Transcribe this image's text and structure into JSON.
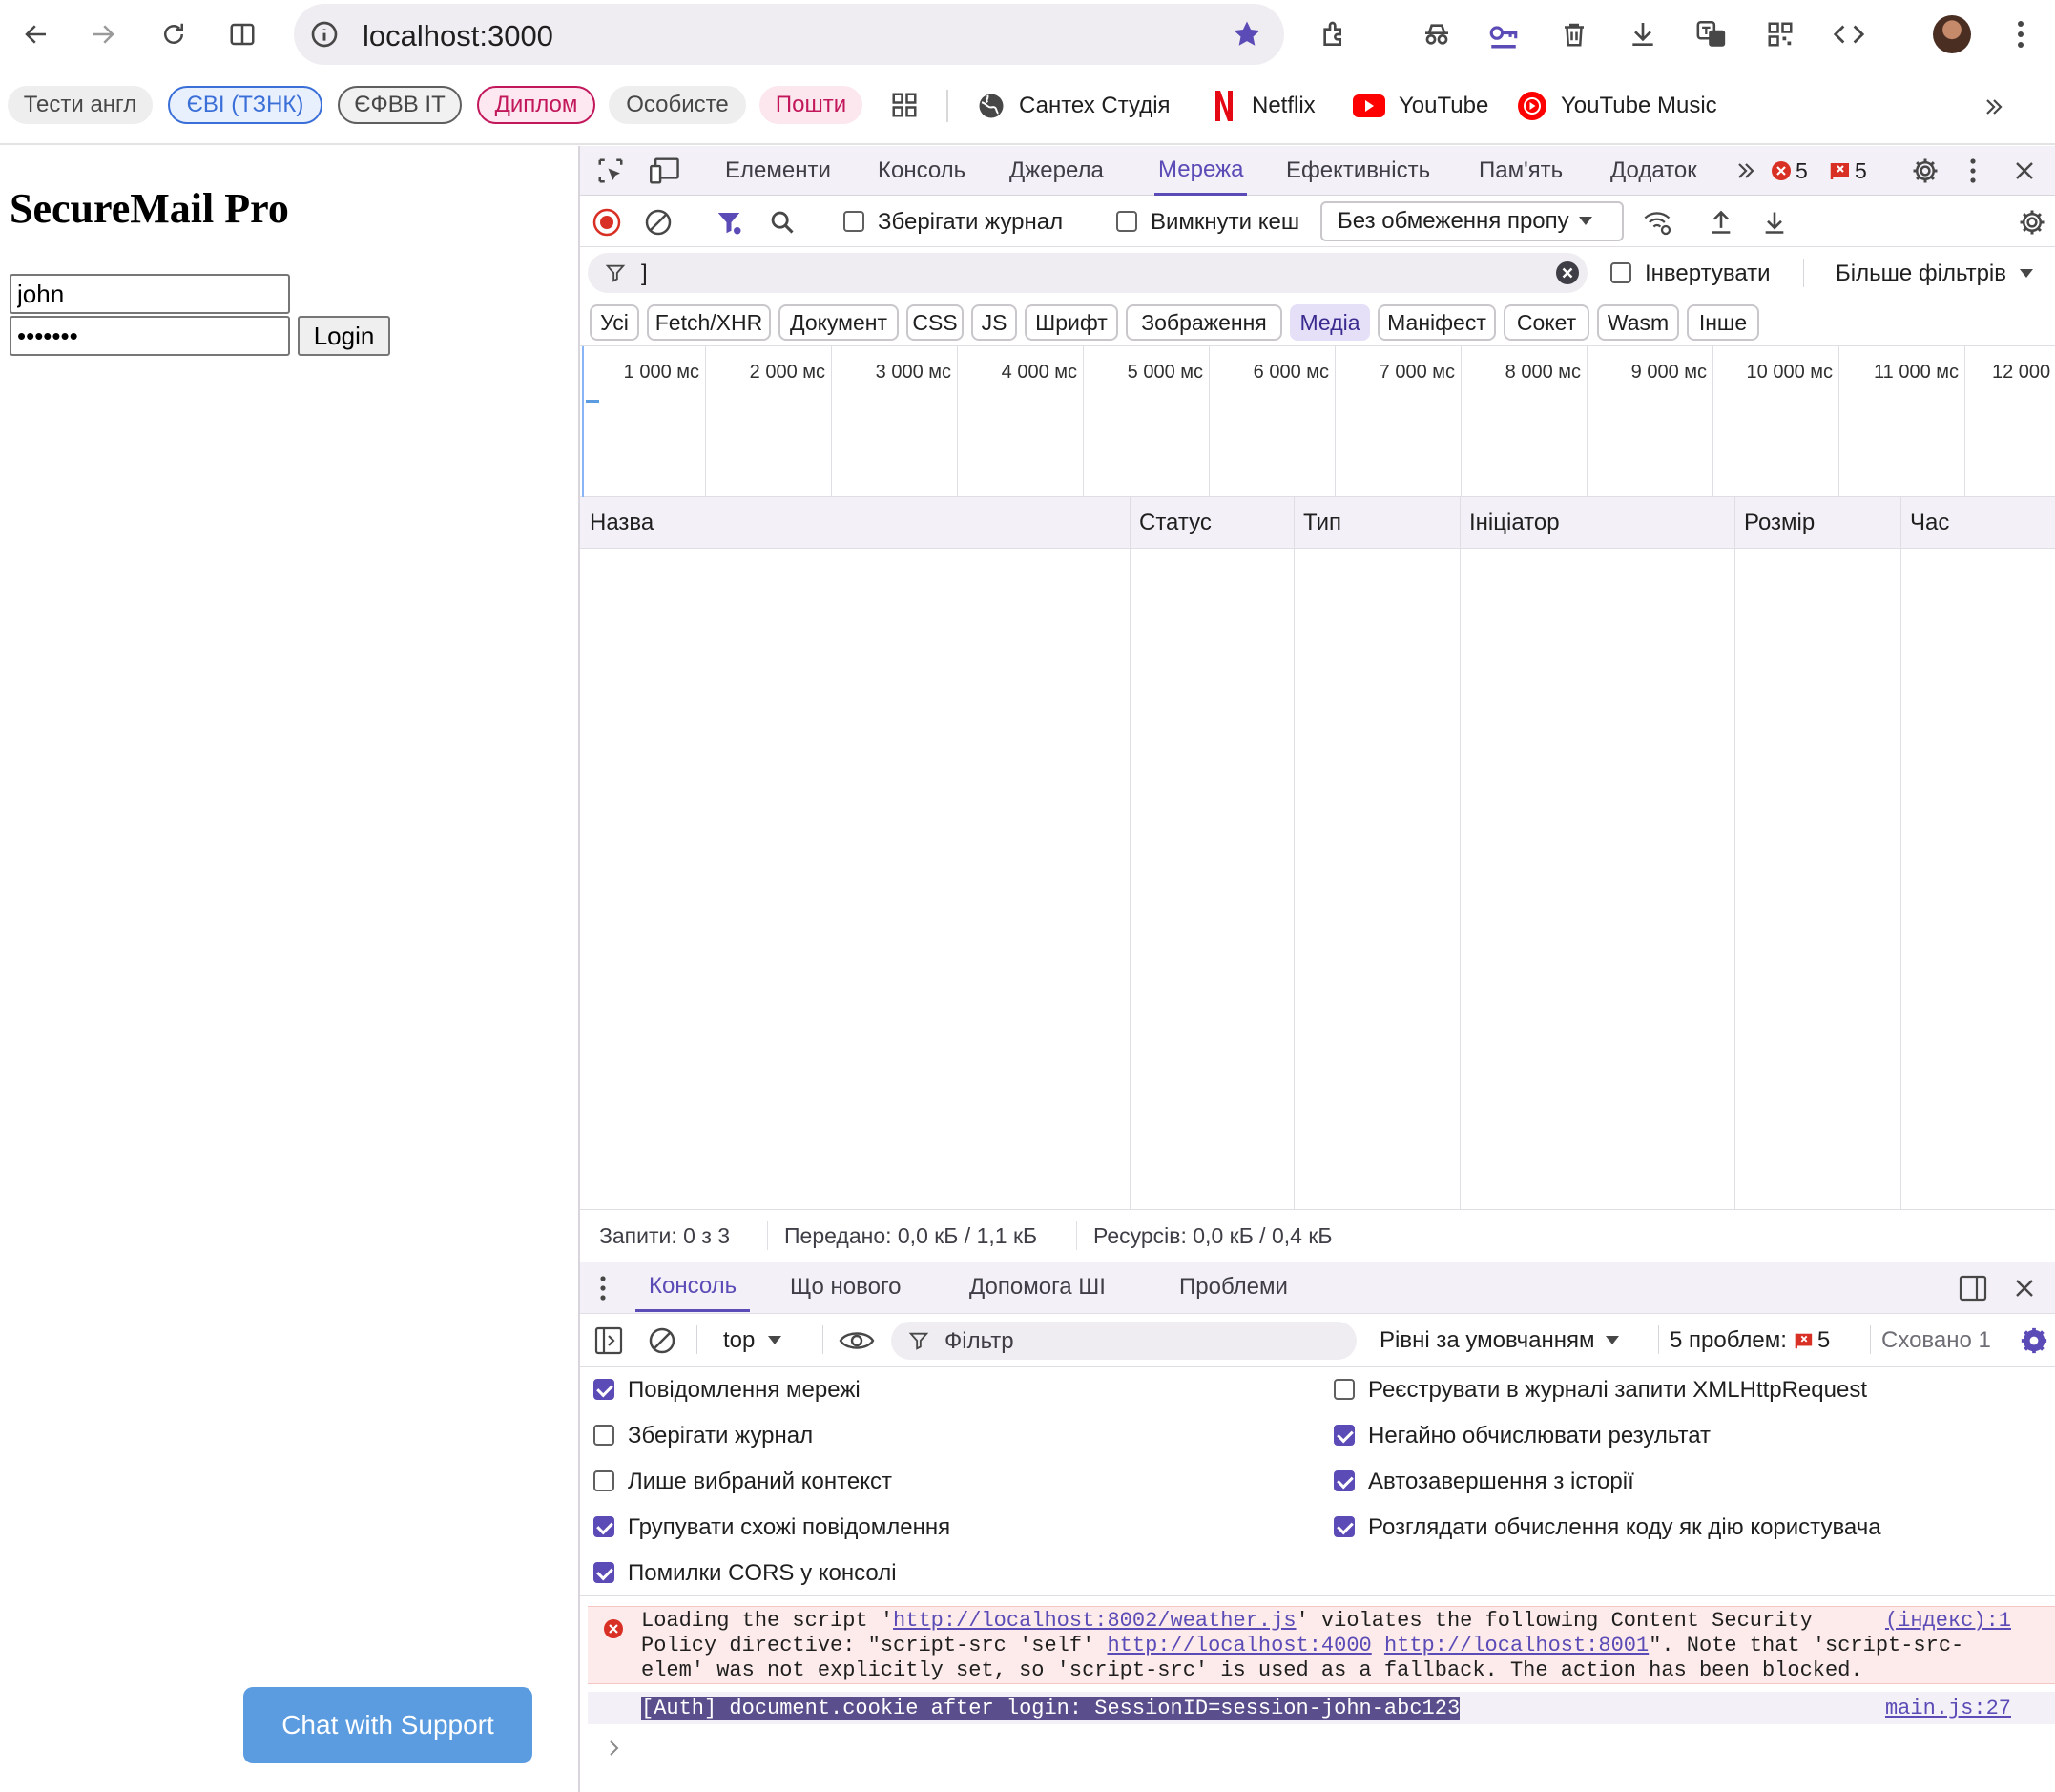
{
  "browser": {
    "url": "localhost:3000",
    "bookmarks": {
      "chips": [
        "Тести англ",
        "ЄВІ (ТЗНК)",
        "ЄФВВ ІТ",
        "Диплом",
        "Особисте",
        "Пошти"
      ],
      "links": [
        "Сантех Студія",
        "Netflix",
        "YouTube",
        "YouTube Music"
      ]
    }
  },
  "page": {
    "title": "SecureMail Pro",
    "username_value": "john",
    "password_value": "•••••••",
    "login_label": "Login",
    "chat_label": "Chat with Support"
  },
  "devtools": {
    "tabs": [
      "Елементи",
      "Консоль",
      "Джерела",
      "Мережа",
      "Ефективність",
      "Пам'ять",
      "Додаток"
    ],
    "active_tab": "Мережа",
    "error_count": "5",
    "issue_count": "5",
    "network": {
      "preserve_log": "Зберігати журнал",
      "disable_cache": "Вимкнути кеш",
      "throttling": "Без обмеження пропу",
      "filter_value": "]",
      "invert": "Інвертувати",
      "more_filters": "Більше фільтрів",
      "types": [
        "Усі",
        "Fetch/XHR",
        "Документ",
        "CSS",
        "JS",
        "Шрифт",
        "Зображення",
        "Медіа",
        "Маніфест",
        "Сокет",
        "Wasm",
        "Інше"
      ],
      "selected_type": "Медіа",
      "timeline_ticks": [
        "1 000 мс",
        "2 000 мс",
        "3 000 мс",
        "4 000 мс",
        "5 000 мс",
        "6 000 мс",
        "7 000 мс",
        "8 000 мс",
        "9 000 мс",
        "10 000 мс",
        "11 000 мс",
        "12 000"
      ],
      "columns": [
        "Назва",
        "Статус",
        "Тип",
        "Ініціатор",
        "Розмір",
        "Час"
      ],
      "status": {
        "requests": "Запити: 0 з 3",
        "transferred": "Передано: 0,0 кБ / 1,1 кБ",
        "resources": "Ресурсів: 0,0 кБ / 0,4 кБ"
      }
    },
    "drawer": {
      "tabs": [
        "Консоль",
        "Що нового",
        "Допомога ШІ",
        "Проблеми"
      ],
      "active_tab": "Консоль",
      "context": "top",
      "filter_placeholder": "Фільтр",
      "levels": "Рівні за умовчанням",
      "problems_label": "5 проблем:",
      "problems_count": "5",
      "hidden": "Сховано 1",
      "settings_left": [
        {
          "label": "Повідомлення мережі",
          "checked": true
        },
        {
          "label": "Зберігати журнал",
          "checked": false
        },
        {
          "label": "Лише вибраний контекст",
          "checked": false
        },
        {
          "label": "Групувати схожі повідомлення",
          "checked": true
        },
        {
          "label": "Помилки CORS у консолі",
          "checked": true
        }
      ],
      "settings_right": [
        {
          "label": "Реєструвати в журналі запити XMLHttpRequest",
          "checked": false
        },
        {
          "label": "Негайно обчислювати результат",
          "checked": true
        },
        {
          "label": "Автозавершення з історії",
          "checked": true
        },
        {
          "label": "Розглядати обчислення коду як дію користувача",
          "checked": true
        }
      ],
      "messages": {
        "error": {
          "l1a": "Loading the script '",
          "l1link": "http://localhost:8002/weather.js",
          "l1b": "' violates the following Content Security",
          "l2a": "Policy directive: \"script-src 'self' ",
          "l2link1": "http://localhost:4000",
          "l2link2": "http://localhost:8001",
          "l2b": "\". Note that 'script-src-",
          "l3": "elem' was not explicitly set, so 'script-src' is used as a fallback. The action has been blocked.",
          "source": "(індекс):1"
        },
        "log": {
          "text": "[Auth] document.cookie after login: SessionID=session-john-abc123",
          "source": "main.js:27"
        }
      }
    }
  },
  "colors": {
    "accent": "#5b4bb6",
    "error": "#d93025",
    "chat_button": "#5b9be0"
  }
}
